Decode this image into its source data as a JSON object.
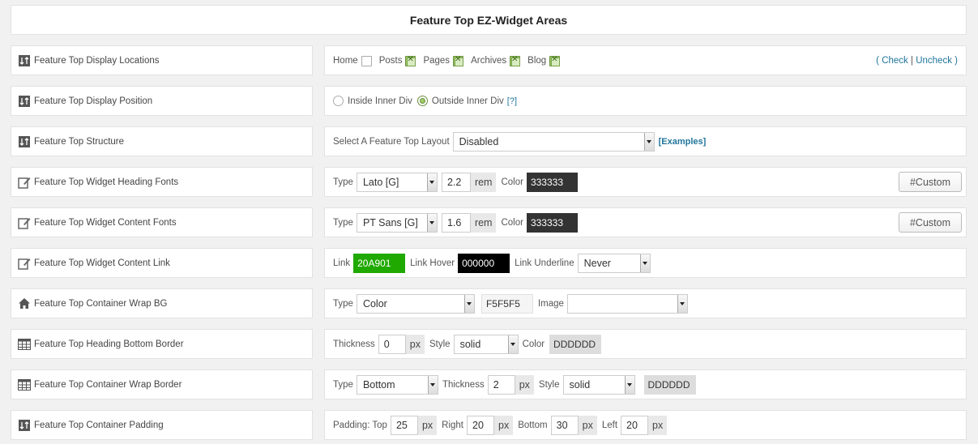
{
  "panel_title": "Feature Top EZ-Widget Areas",
  "rows": [
    {
      "label": "Feature Top Display Locations",
      "icon": "sort-arrows-icon"
    },
    {
      "label": "Feature Top Display Position",
      "icon": "sort-arrows-icon"
    },
    {
      "label": "Feature Top Structure",
      "icon": "sort-arrows-icon"
    },
    {
      "label": "Feature Top Widget Heading Fonts",
      "icon": "edit-icon"
    },
    {
      "label": "Feature Top Widget Content Fonts",
      "icon": "edit-icon"
    },
    {
      "label": "Feature Top Widget Content Link",
      "icon": "edit-icon"
    },
    {
      "label": "Feature Top Container Wrap BG",
      "icon": "home-icon"
    },
    {
      "label": "Feature Top Heading Bottom Border",
      "icon": "grid-icon"
    },
    {
      "label": "Feature Top Container Wrap Border",
      "icon": "grid-icon"
    },
    {
      "label": "Feature Top Container Padding",
      "icon": "sort-arrows-icon"
    }
  ],
  "locations": {
    "home": "Home",
    "posts": "Posts",
    "pages": "Pages",
    "archives": "Archives",
    "blog": "Blog",
    "home_checked": false,
    "posts_checked": true,
    "pages_checked": true,
    "archives_checked": true,
    "blog_checked": true,
    "open_paren": "(",
    "check": "Check",
    "sep": "|",
    "uncheck": "Uncheck",
    "close_paren": ")"
  },
  "position": {
    "inside": "Inside Inner Div",
    "outside": "Outside Inner Div",
    "help": "[?]",
    "selected": "outside"
  },
  "structure": {
    "label": "Select A Feature Top Layout",
    "value": "Disabled",
    "examples": "[Examples]"
  },
  "heading_fonts": {
    "type_label": "Type",
    "type": "Lato [G]",
    "size": "2.2",
    "unit": "rem",
    "color_label": "Color",
    "color": "333333",
    "custom_btn": "#Custom"
  },
  "content_fonts": {
    "type_label": "Type",
    "type": "PT Sans [G]",
    "size": "1.6",
    "unit": "rem",
    "color_label": "Color",
    "color": "333333",
    "custom_btn": "#Custom"
  },
  "content_link": {
    "link_label": "Link",
    "link_color": "20A901",
    "hover_label": "Link Hover",
    "hover_color": "000000",
    "underline_label": "Link Underline",
    "underline": "Never"
  },
  "wrap_bg": {
    "type_label": "Type",
    "type": "Color",
    "color": "F5F5F5",
    "image_label": "Image",
    "image": ""
  },
  "heading_border": {
    "thickness_label": "Thickness",
    "thickness": "0",
    "unit": "px",
    "style_label": "Style",
    "style": "solid",
    "color_label": "Color",
    "color": "DDDDDD"
  },
  "wrap_border": {
    "type_label": "Type",
    "type": "Bottom",
    "thickness_label": "Thickness",
    "thickness": "2",
    "unit": "px",
    "style_label": "Style",
    "style": "solid",
    "color": "DDDDDD"
  },
  "padding": {
    "top_label": "Padding: Top",
    "top": "25",
    "right_label": "Right",
    "right": "20",
    "bottom_label": "Bottom",
    "bottom": "30",
    "left_label": "Left",
    "left": "20",
    "unit": "px"
  },
  "colors": {
    "link_green": "#20A901",
    "dark_swatch": "#333333",
    "black": "#000000",
    "light_gray": "#F5F5F5",
    "border_gray": "#DDDDDD"
  }
}
